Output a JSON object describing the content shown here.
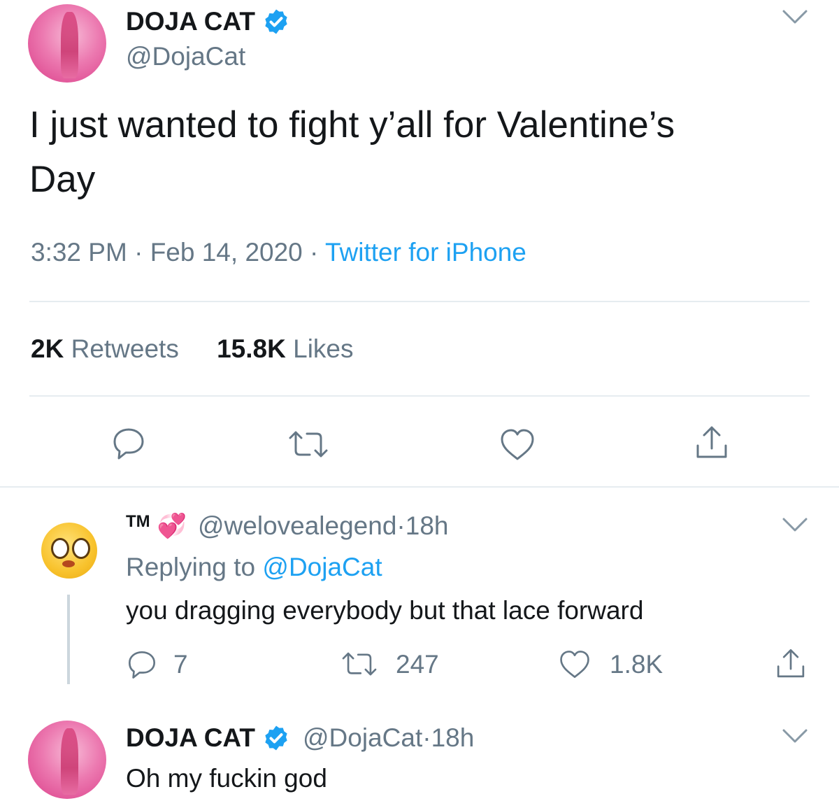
{
  "main_tweet": {
    "author_name": "DOJA CAT",
    "author_handle": "@DojaCat",
    "text_line1": "I just wanted to fight y’all for Valentine’s",
    "text_line2": "Day",
    "time": "3:32 PM",
    "sep1": " · ",
    "date": "Feb 14, 2020",
    "sep2": " · ",
    "source": "Twitter for iPhone",
    "retweets_count": "2K",
    "retweets_label": "Retweets",
    "likes_count": "15.8K",
    "likes_label": "Likes",
    "icons": [
      "reply-icon",
      "retweet-icon",
      "like-icon",
      "share-icon"
    ]
  },
  "reply1": {
    "author_name": "TM",
    "author_emoji": "💞",
    "author_handle": "@welovealegend",
    "sep": " · ",
    "age": "18h",
    "replying_prefix": "Replying to ",
    "replying_handle": "@DojaCat",
    "text": "you dragging everybody but that lace forward",
    "reply_count": "7",
    "retweet_count": "247",
    "like_count": "1.8K"
  },
  "reply2": {
    "author_name": "DOJA CAT",
    "author_handle": "@DojaCat",
    "sep": " · ",
    "age": "18h",
    "text": "Oh my fuckin god"
  },
  "colors": {
    "text": "#14171a",
    "secondary": "#657786",
    "accent": "#1da1f2",
    "divider": "#e6ecf0"
  }
}
